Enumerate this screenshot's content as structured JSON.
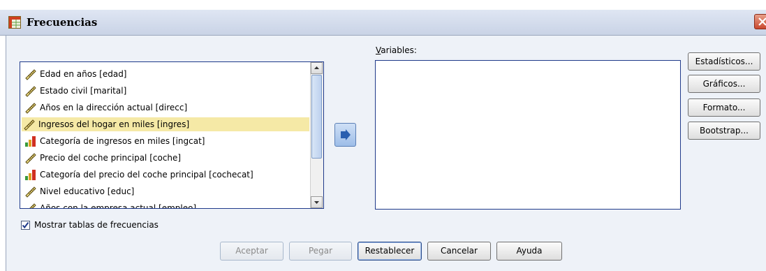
{
  "window": {
    "title": "Frecuencias"
  },
  "source_list": {
    "items": [
      {
        "label": "Edad en años [edad]",
        "icon": "scale-ruler-icon",
        "selected": false
      },
      {
        "label": "Estado civil [marital]",
        "icon": "scale-ruler-icon",
        "selected": false
      },
      {
        "label": "Años en la dirección actual [direcc]",
        "icon": "scale-ruler-icon",
        "selected": false
      },
      {
        "label": "Ingresos del hogar en miles [ingres]",
        "icon": "scale-ruler-icon",
        "selected": true
      },
      {
        "label": "Categoría de ingresos en miles [ingcat]",
        "icon": "ordinal-bars-icon",
        "selected": false
      },
      {
        "label": "Precio del coche principal [coche]",
        "icon": "scale-ruler-icon",
        "selected": false
      },
      {
        "label": "Categoría del precio del coche principal [cochecat]",
        "icon": "ordinal-bars-icon",
        "selected": false
      },
      {
        "label": "Nivel educativo [educ]",
        "icon": "scale-ruler-icon",
        "selected": false
      },
      {
        "label": "Años con la empresa actual [empleo]",
        "icon": "scale-ruler-icon",
        "selected": false
      }
    ]
  },
  "variables": {
    "label": "Variables:"
  },
  "side_buttons": {
    "statistics": "Estadísticos...",
    "charts": "Gráficos...",
    "format": "Formato...",
    "bootstrap": "Bootstrap..."
  },
  "checkbox": {
    "label": "Mostrar tablas de frecuencias",
    "checked": true
  },
  "bottom_buttons": {
    "ok": "Aceptar",
    "paste": "Pegar",
    "reset": "Restablecer",
    "cancel": "Cancelar",
    "help": "Ayuda"
  },
  "colors": {
    "selection": "#f5e9a6",
    "list_border": "#1f3a8a",
    "client_bg": "#eef2f8"
  }
}
